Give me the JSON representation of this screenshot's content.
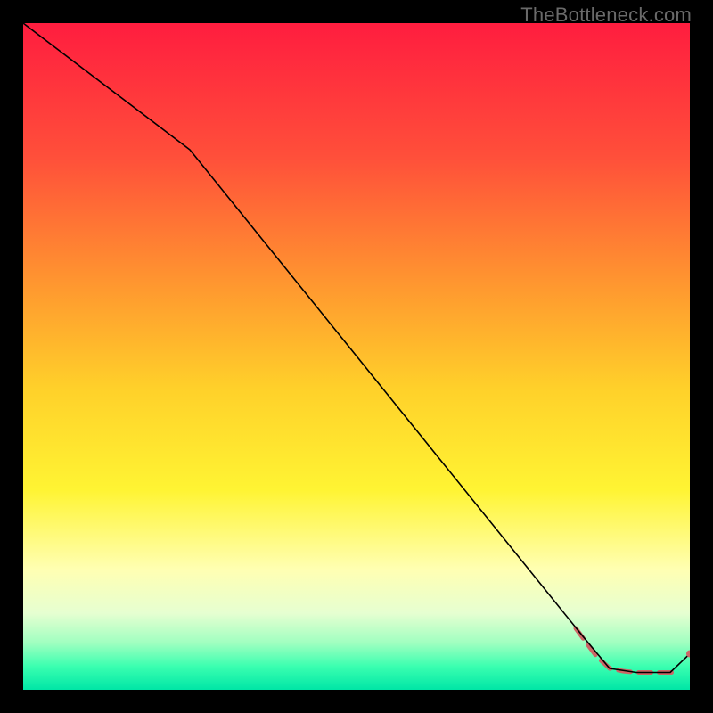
{
  "watermark": "TheBottleneck.com",
  "chart_data": {
    "type": "line",
    "title": "",
    "xlabel": "",
    "ylabel": "",
    "xlim": [
      0,
      100
    ],
    "ylim": [
      0,
      100
    ],
    "grid": false,
    "legend": false,
    "background_gradient": {
      "stops": [
        {
          "offset": 0.0,
          "color": "#ff1d3f"
        },
        {
          "offset": 0.2,
          "color": "#ff4f3a"
        },
        {
          "offset": 0.4,
          "color": "#ff9a2f"
        },
        {
          "offset": 0.55,
          "color": "#ffd12a"
        },
        {
          "offset": 0.7,
          "color": "#fff433"
        },
        {
          "offset": 0.82,
          "color": "#ffffb3"
        },
        {
          "offset": 0.885,
          "color": "#e6ffd1"
        },
        {
          "offset": 0.93,
          "color": "#9fffc0"
        },
        {
          "offset": 0.965,
          "color": "#3affb0"
        },
        {
          "offset": 1.0,
          "color": "#00e6a6"
        }
      ]
    },
    "series": [
      {
        "name": "main-curve",
        "style": "solid",
        "color": "#000000",
        "width": 1.6,
        "points": [
          {
            "x": 0,
            "y": 100
          },
          {
            "x": 25,
            "y": 81
          },
          {
            "x": 84,
            "y": 8
          },
          {
            "x": 88,
            "y": 3.2
          },
          {
            "x": 92,
            "y": 2.6
          },
          {
            "x": 97,
            "y": 2.6
          },
          {
            "x": 100,
            "y": 5.4
          }
        ]
      },
      {
        "name": "dashed-tail",
        "style": "dashed",
        "color": "#cc6666",
        "width": 5,
        "points": [
          {
            "x": 83,
            "y": 9.2
          },
          {
            "x": 86,
            "y": 5.0
          },
          {
            "x": 88,
            "y": 3.2
          },
          {
            "x": 90,
            "y": 2.8
          },
          {
            "x": 92,
            "y": 2.6
          },
          {
            "x": 94,
            "y": 2.6
          },
          {
            "x": 96,
            "y": 2.6
          },
          {
            "x": 98,
            "y": 2.6
          }
        ]
      }
    ],
    "marker": {
      "name": "end-marker",
      "color": "#cc6666",
      "radius": 4,
      "point": {
        "x": 100,
        "y": 5.4
      }
    }
  }
}
